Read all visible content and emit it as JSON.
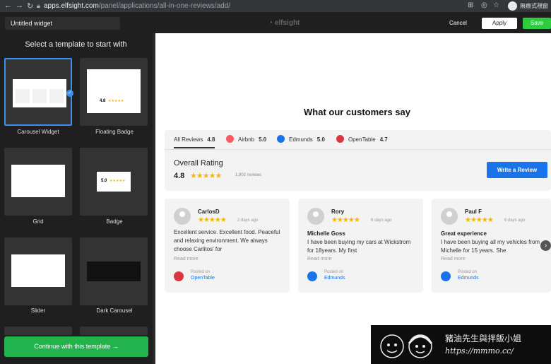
{
  "browser": {
    "url_domain": "apps.elfsight.com",
    "url_path": "/panel/applications/all-in-one-reviews/add/",
    "profile_name": "無痕式視窗"
  },
  "appbar": {
    "widget_name": "Untitled widget",
    "logo": "elfsight",
    "cancel_label": "Cancel",
    "apply_label": "Apply",
    "save_label": "Save",
    "accent_save": "#2ecc40"
  },
  "sidebar": {
    "heading": "Select a template to start with",
    "templates": [
      {
        "label": "Carousel Widget",
        "selected": true
      },
      {
        "label": "Floating Badge",
        "selected": false
      },
      {
        "label": "Grid",
        "selected": false
      },
      {
        "label": "Badge",
        "selected": false
      },
      {
        "label": "Slider",
        "selected": false
      },
      {
        "label": "Dark Carousel",
        "selected": false
      }
    ],
    "floating_badge_score": "4.8",
    "badge_score": "5.0",
    "continue_label": "Continue with this template",
    "continue_arrow": "→"
  },
  "widget": {
    "title": "What our customers say",
    "tabs": [
      {
        "label": "All Reviews",
        "score": "4.8",
        "icon": "all",
        "color": "#333333"
      },
      {
        "label": "Airbnb",
        "score": "5.0",
        "icon": "airbnb-icon",
        "color": "#ff5a5f"
      },
      {
        "label": "Edmunds",
        "score": "5.0",
        "icon": "edmunds-icon",
        "color": "#1a73e8"
      },
      {
        "label": "OpenTable",
        "score": "4.7",
        "icon": "opentable-icon",
        "color": "#da3743"
      }
    ],
    "overall_label": "Overall Rating",
    "overall_score": "4.8",
    "overall_stars": "★★★★★",
    "review_count": "1,802 reviews",
    "write_review": "Write a Review",
    "reviews": [
      {
        "name": "CarlosD",
        "stars": "★★★★★",
        "date": "2 days ago",
        "title": "",
        "text": "Excellent service. Excellent food. Peaceful and relaxing environment. We always choose Carlitos' for",
        "more": "Read more",
        "posted": "Posted on",
        "source": "OpenTable",
        "source_color": "#da3743"
      },
      {
        "name": "Rory",
        "stars": "★★★★★",
        "date": "6 days ago",
        "title": "Michelle Goss",
        "text": "I have been buying my cars at Wickstrom for 18years. My first",
        "more": "Read more",
        "posted": "Posted on",
        "source": "Edmunds",
        "source_color": "#1a73e8"
      },
      {
        "name": "Paul F",
        "stars": "★★★★★",
        "date": "6 days ago",
        "title": "Great experience",
        "text": "I have been buying all my vehicles from Michelle for 15 years. She",
        "more": "Read more",
        "posted": "Posted on",
        "source": "Edmunds",
        "source_color": "#1a73e8"
      }
    ],
    "next_arrow": "›"
  },
  "watermark": {
    "text": "豬油先生與拌飯小姐",
    "url": "https://mmmo.cc/"
  }
}
